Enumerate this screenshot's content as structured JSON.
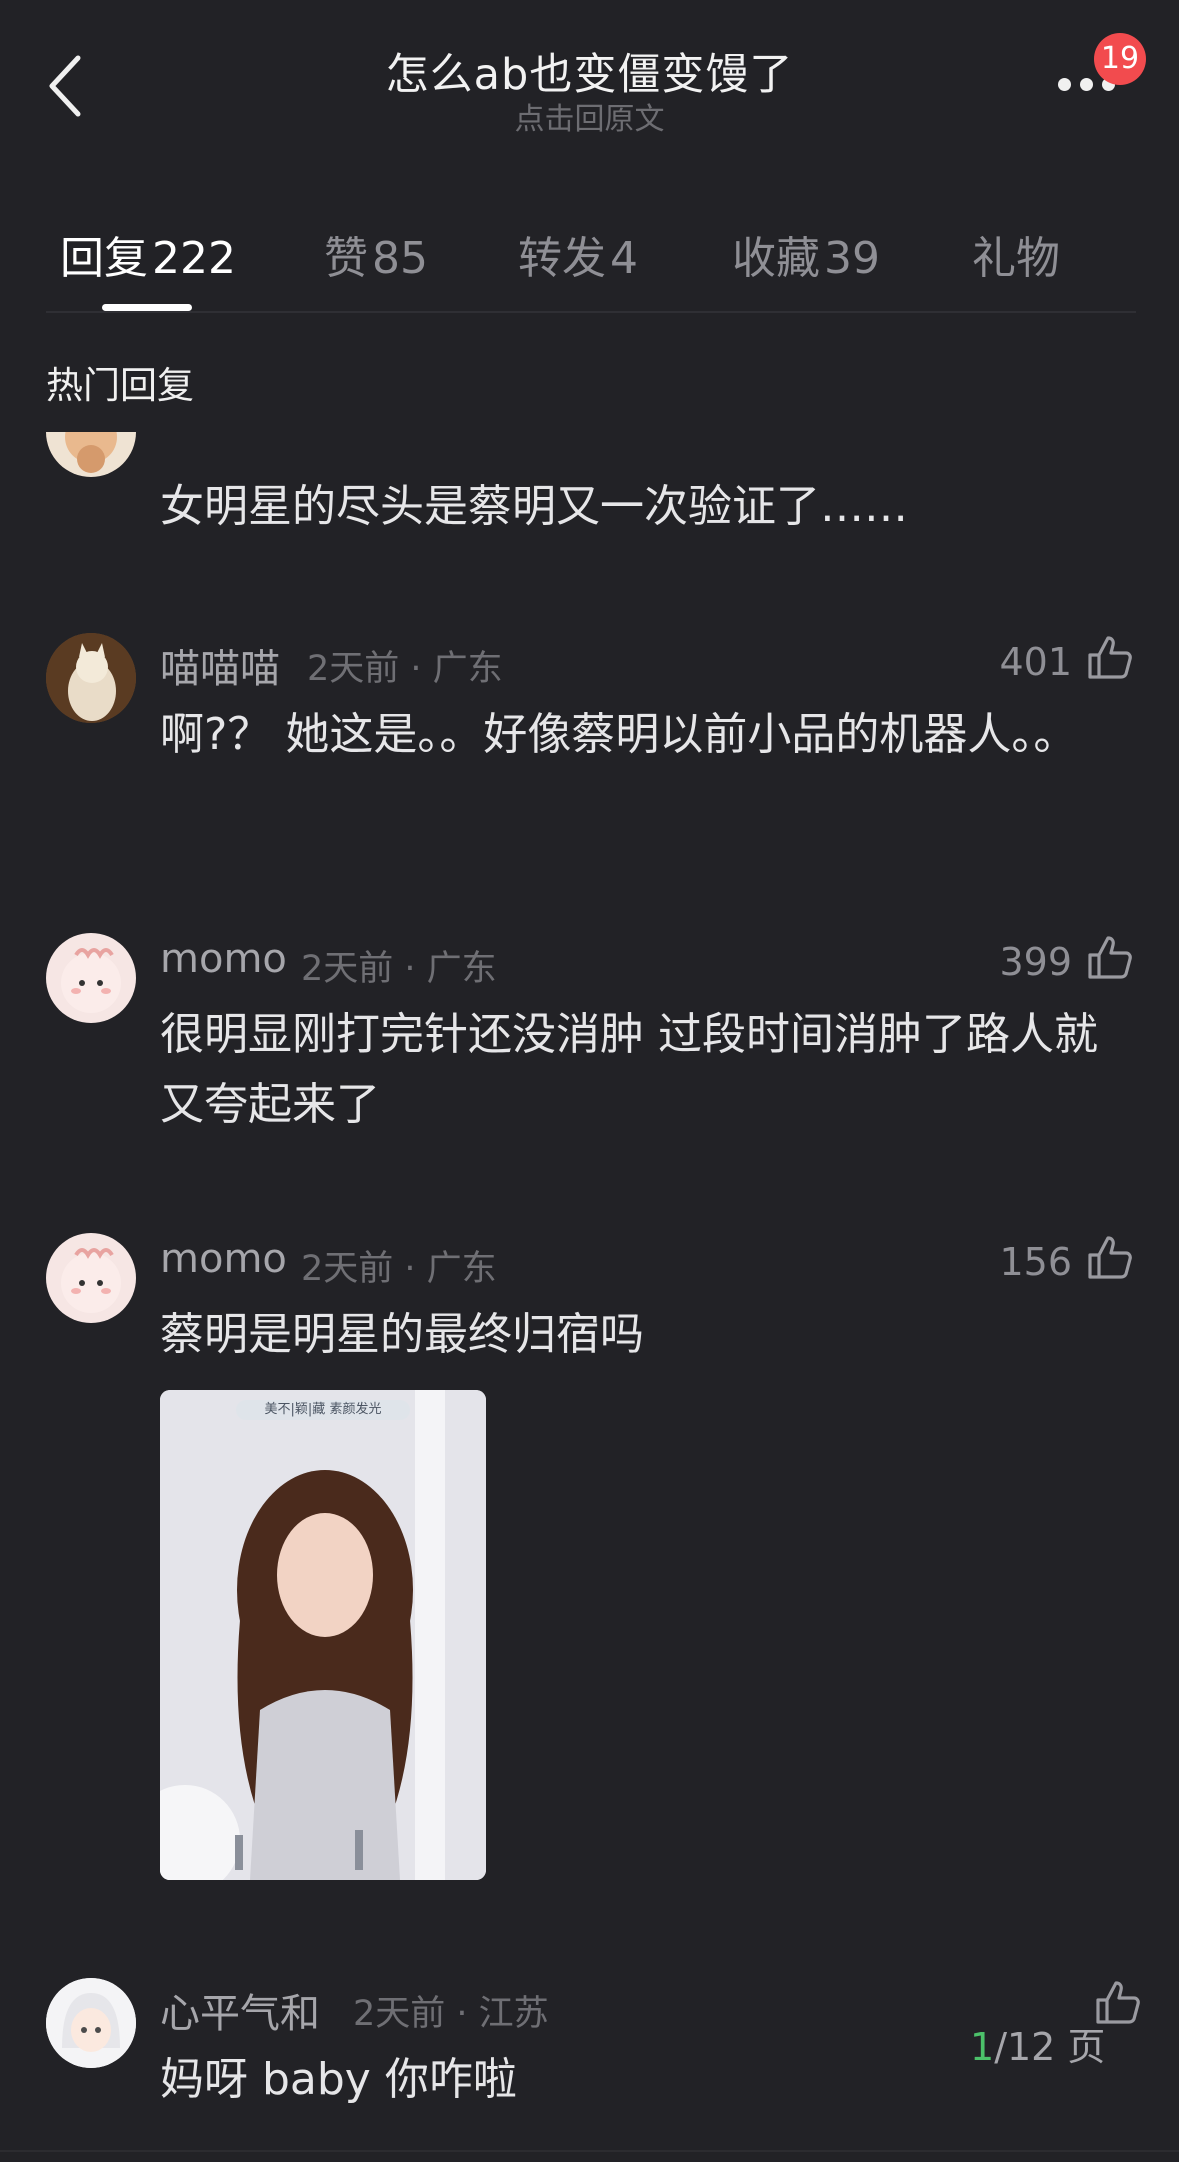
{
  "header": {
    "title": "怎么ab也变僵变馒了",
    "subtitle": "点击回原文",
    "notification_count": "19"
  },
  "tabs": [
    {
      "label": "回复",
      "count": "222"
    },
    {
      "label": "赞",
      "count": "85"
    },
    {
      "label": "转发",
      "count": "4"
    },
    {
      "label": "收藏",
      "count": "39"
    },
    {
      "label": "礼物",
      "count": ""
    }
  ],
  "section_title": "热门回复",
  "comments": [
    {
      "username": "",
      "time": "",
      "location": "",
      "likes": "",
      "text": "女明星的尽头是蔡明又一次验证了……"
    },
    {
      "username": "喵喵喵",
      "time": "2天前",
      "location": "广东",
      "likes": "401",
      "text": "啊?？ 她这是。。好像蔡明以前小品的机器人。。"
    },
    {
      "username": "momo",
      "time": "2天前",
      "location": "广东",
      "likes": "399",
      "text": "很明显刚打完针还没消肿 过段时间消肿了路人就又夸起来了"
    },
    {
      "username": "momo",
      "time": "2天前",
      "location": "广东",
      "likes": "156",
      "text": "蔡明是明星的最终归宿吗",
      "image_caption": "美不|颖|藏 素颜发光"
    },
    {
      "username": "心平气和",
      "time": "2天前",
      "location": "江苏",
      "likes": "",
      "text": "妈呀 baby 你咋啦"
    }
  ],
  "pager": {
    "current": "1",
    "total_label": "/12 页"
  },
  "colors": {
    "background": "#222226",
    "accent_green": "#4cc16a",
    "badge_red": "#f24b4e"
  }
}
